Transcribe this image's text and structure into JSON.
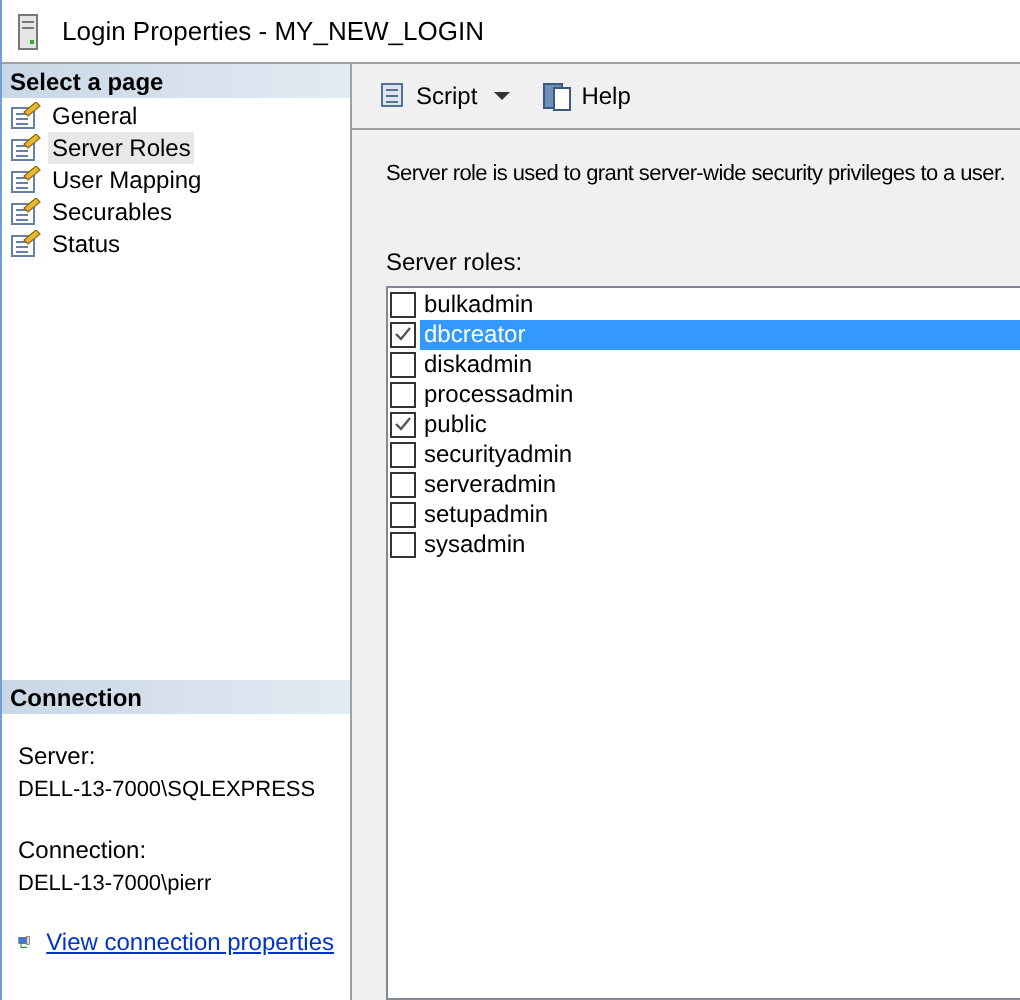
{
  "window": {
    "title": "Login Properties - MY_NEW_LOGIN"
  },
  "sidebar": {
    "header": "Select a page",
    "items": [
      {
        "label": "General",
        "selected": false
      },
      {
        "label": "Server Roles",
        "selected": true
      },
      {
        "label": "User Mapping",
        "selected": false
      },
      {
        "label": "Securables",
        "selected": false
      },
      {
        "label": "Status",
        "selected": false
      }
    ]
  },
  "connection": {
    "header": "Connection",
    "server_label": "Server:",
    "server": "DELL-13-7000\\SQLEXPRESS",
    "connection_label": "Connection:",
    "connection": "DELL-13-7000\\pierr",
    "link": "View connection properties"
  },
  "toolbar": {
    "script": "Script",
    "help": "Help"
  },
  "description": "Server role is used to grant server-wide security privileges to a user.",
  "roles_label": "Server roles:",
  "roles": [
    {
      "name": "bulkadmin",
      "checked": false,
      "selected": false
    },
    {
      "name": "dbcreator",
      "checked": true,
      "selected": true
    },
    {
      "name": "diskadmin",
      "checked": false,
      "selected": false
    },
    {
      "name": "processadmin",
      "checked": false,
      "selected": false
    },
    {
      "name": "public",
      "checked": true,
      "selected": false
    },
    {
      "name": "securityadmin",
      "checked": false,
      "selected": false
    },
    {
      "name": "serveradmin",
      "checked": false,
      "selected": false
    },
    {
      "name": "setupadmin",
      "checked": false,
      "selected": false
    },
    {
      "name": "sysadmin",
      "checked": false,
      "selected": false
    }
  ]
}
